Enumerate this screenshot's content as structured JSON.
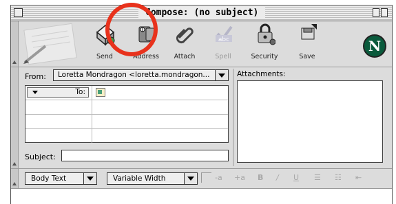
{
  "window": {
    "title": "Compose: (no subject)"
  },
  "toolbar": {
    "buttons": [
      {
        "label": "Send",
        "icon": "send-icon",
        "enabled": true
      },
      {
        "label": "Address",
        "icon": "address-book-icon",
        "enabled": true
      },
      {
        "label": "Attach",
        "icon": "paperclip-icon",
        "enabled": true
      },
      {
        "label": "Spell",
        "icon": "spellcheck-icon",
        "enabled": false
      },
      {
        "label": "Security",
        "icon": "lock-icon",
        "enabled": true
      },
      {
        "label": "Save",
        "icon": "save-icon",
        "enabled": true
      }
    ],
    "logo_letter": "N"
  },
  "header": {
    "from_label": "From:",
    "from_value": "Loretta Mondragon <loretta.mondragon...",
    "address_rows": [
      {
        "type": "To:"
      },
      {
        "type": ""
      },
      {
        "type": ""
      },
      {
        "type": ""
      }
    ],
    "subject_label": "Subject:",
    "subject_value": "",
    "attachments_label": "Attachments:"
  },
  "format_bar": {
    "paragraph_style": "Body Text",
    "font": "Variable Width",
    "tools": [
      "-a",
      "+a",
      "B",
      "/",
      "U",
      "☰",
      "☷",
      "⇤"
    ]
  },
  "annotation": {
    "highlight_color": "#e8321c",
    "highlighted_item": "Address"
  }
}
